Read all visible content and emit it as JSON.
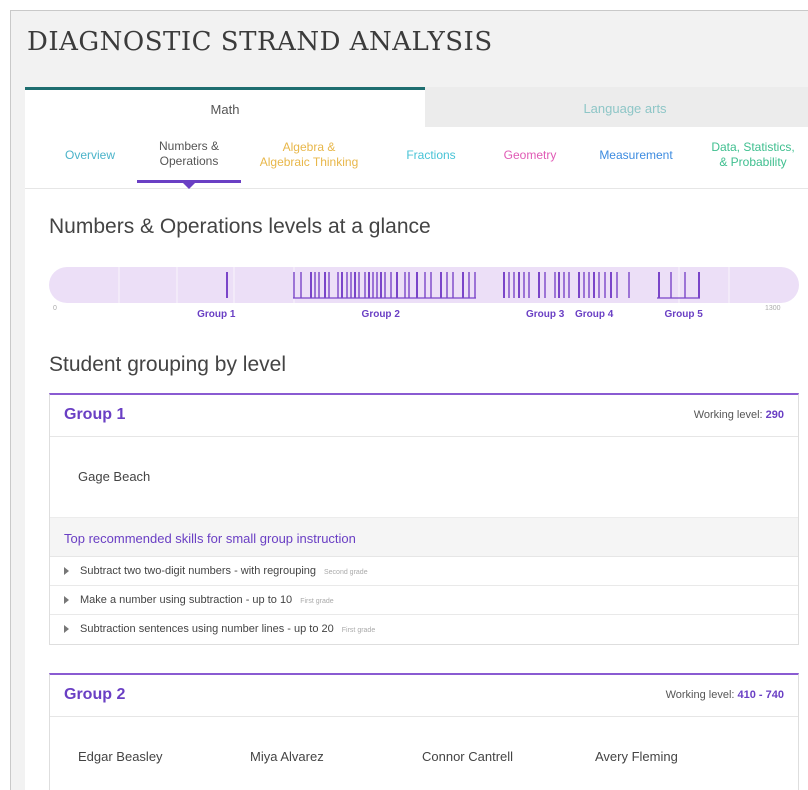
{
  "page": {
    "title": "DIAGNOSTIC STRAND ANALYSIS"
  },
  "subject_tabs": [
    {
      "label": "Math",
      "active": true
    },
    {
      "label": "Language arts",
      "active": false
    }
  ],
  "strand_tabs": [
    {
      "label": "Overview",
      "color": "#4ab3c9"
    },
    {
      "label": "Numbers &\nOperations",
      "color": "#555555",
      "active": true
    },
    {
      "label": "Algebra &\nAlgebraic Thinking",
      "color": "#e8b74a"
    },
    {
      "label": "Fractions",
      "color": "#48c3d6"
    },
    {
      "label": "Geometry",
      "color": "#e05ab5"
    },
    {
      "label": "Measurement",
      "color": "#3c8be0"
    },
    {
      "label": "Data, Statistics,\n& Probability",
      "color": "#3fbf8f"
    }
  ],
  "glance": {
    "heading": "Numbers & Operations levels at a glance",
    "scale_min": "0",
    "scale_max": "1300",
    "bar_color": "#ecdff7",
    "line_color": "#7a45c9",
    "groups": [
      {
        "label": "Group 1",
        "marker_level": 290
      },
      {
        "label": "Group 2",
        "marker_level": 575
      },
      {
        "label": "Group 3",
        "marker_level": 860
      },
      {
        "label": "Group 4",
        "marker_level": 945
      },
      {
        "label": "Group 5",
        "marker_level": 1100
      }
    ]
  },
  "grouping": {
    "heading": "Student grouping by level",
    "groups": [
      {
        "name": "Group 1",
        "working_label": "Working level:",
        "working_value": "290",
        "students": [
          "Gage Beach"
        ],
        "recommended_heading": "Top recommended skills for small group instruction",
        "skills": [
          {
            "name": "Subtract two two-digit numbers - with regrouping",
            "grade": "Second grade"
          },
          {
            "name": "Make a number using subtraction - up to 10",
            "grade": "First grade"
          },
          {
            "name": "Subtraction sentences using number lines - up to 20",
            "grade": "First grade"
          }
        ]
      },
      {
        "name": "Group 2",
        "working_label": "Working level:",
        "working_value": "410 - 740",
        "students": [
          "Edgar Beasley",
          "Miya Alvarez",
          "Connor Cantrell",
          "Avery Fleming"
        ]
      }
    ]
  }
}
